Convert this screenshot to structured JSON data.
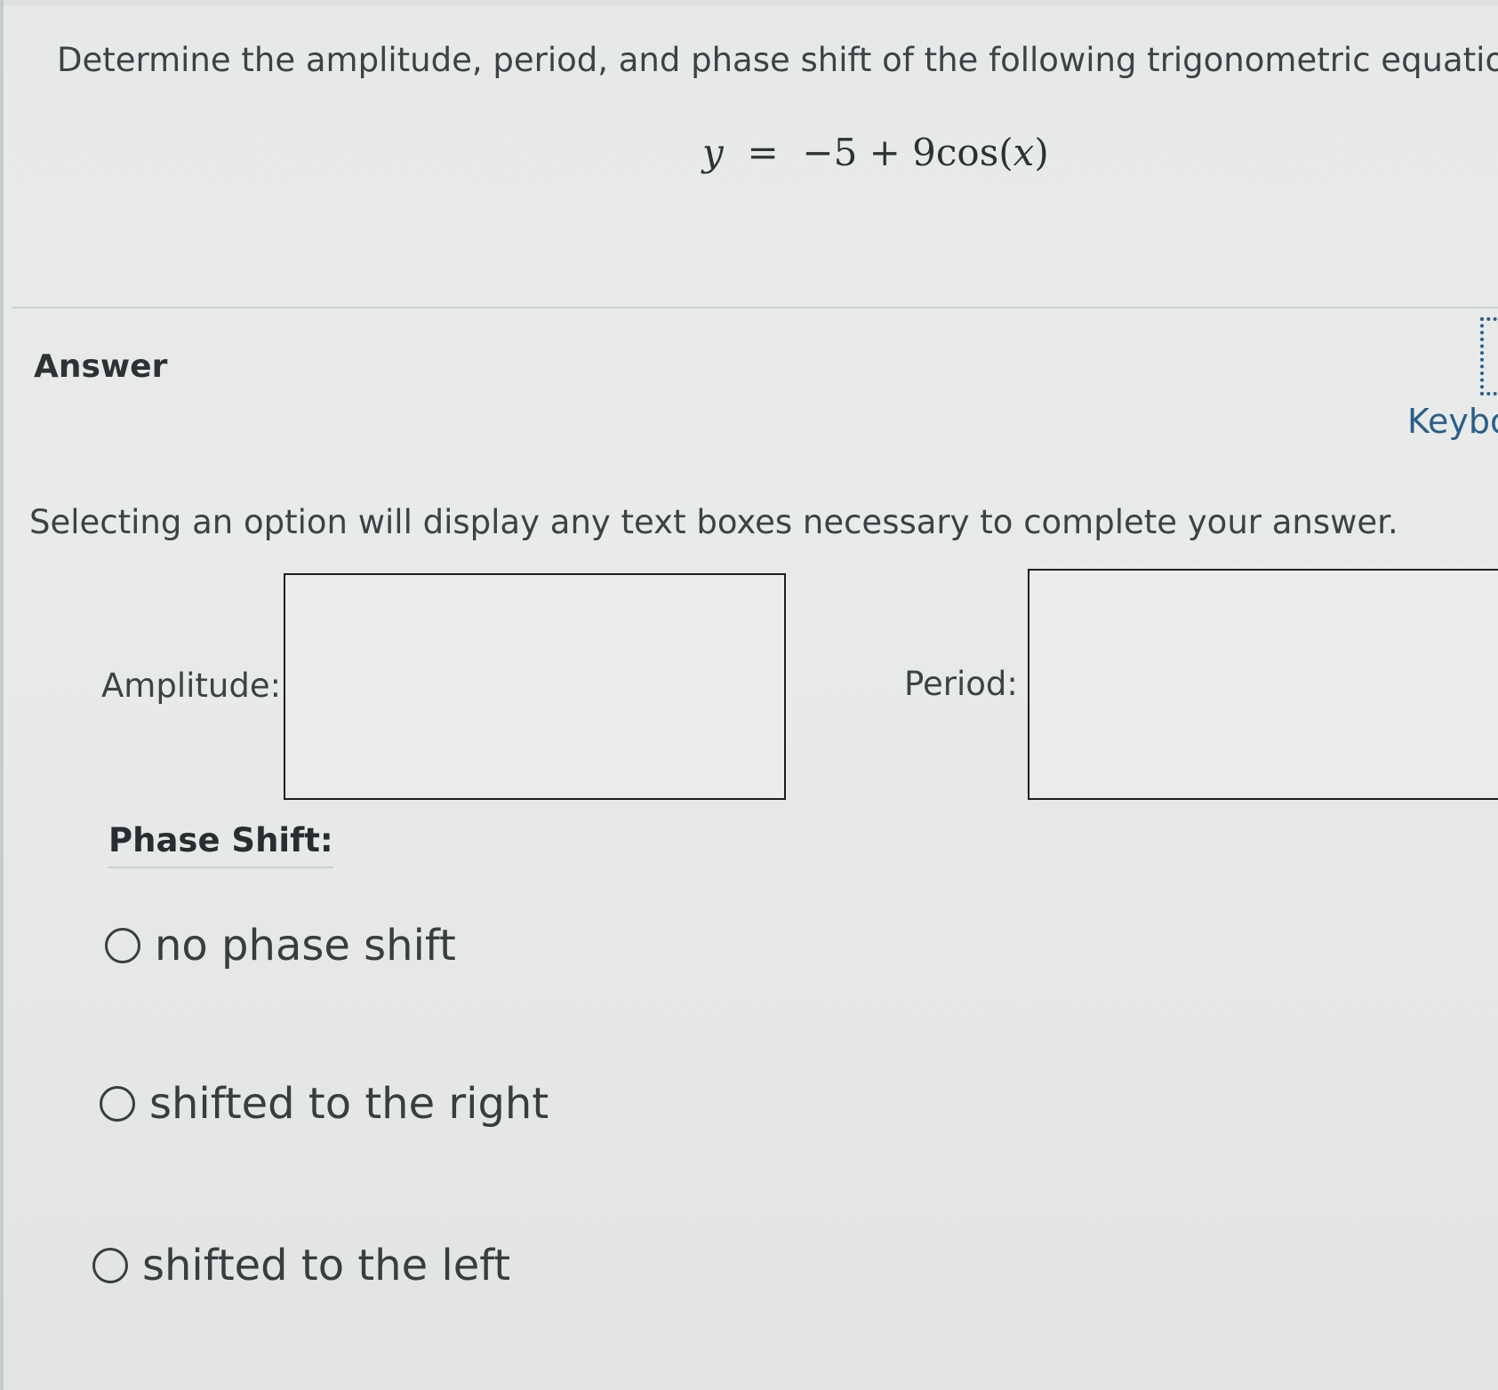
{
  "question": {
    "prompt": "Determine the amplitude, period, and phase shift of the following trigonometric equation.",
    "equation": {
      "lhs": "y",
      "equals": "=",
      "rhs_prefix": "−5 + 9cos(",
      "rhs_var": "x",
      "rhs_suffix": ")"
    }
  },
  "answer": {
    "heading": "Answer",
    "keyboard_label": "Keybo",
    "instructions": "Selecting an option will display any text boxes necessary to complete your answer.",
    "amplitude_label": "Amplitude:",
    "amplitude_value": "",
    "period_label": "Period:",
    "period_value": "",
    "phase_shift_heading": "Phase Shift:",
    "options": [
      {
        "label": "no phase shift",
        "selected": false
      },
      {
        "label": "shifted to the right",
        "selected": false
      },
      {
        "label": "shifted to the left",
        "selected": false
      }
    ]
  },
  "colors": {
    "background": "#e8eaea",
    "text": "#3e4245",
    "link": "#2b5f8a",
    "box_border": "#1e1f20"
  },
  "icons": {
    "keyboard": "keyboard-icon",
    "radio": "radio-circle-icon"
  }
}
